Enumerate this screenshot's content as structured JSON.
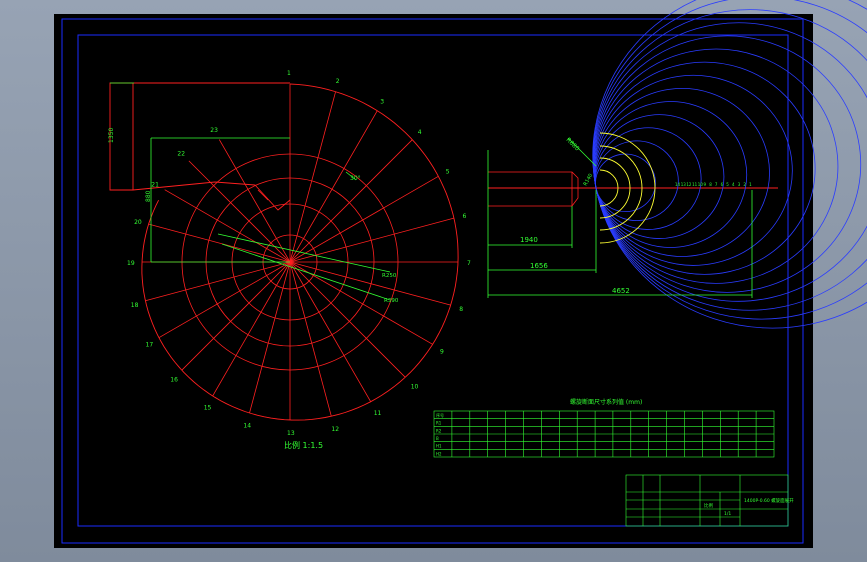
{
  "colors": {
    "background": "#000000",
    "frame_blue": "#1a2bff",
    "line_red": "#ff2020",
    "label_green": "#33ff33",
    "arc_blue": "#2a3cff",
    "arc_yellow": "#ffff33"
  },
  "left_view": {
    "angle_numbers": [
      "1",
      "2",
      "3",
      "4",
      "5",
      "6",
      "7",
      "8",
      "9",
      "10",
      "11",
      "12",
      "13",
      "14",
      "15",
      "16",
      "17",
      "18",
      "19",
      "20",
      "21",
      "22",
      "23"
    ],
    "angle_label": "30°",
    "dim_labels": [
      "R250",
      "R390",
      "1350",
      "880"
    ],
    "scale_caption": "比例 1:1.5"
  },
  "right_view": {
    "dim_1": "1940",
    "dim_2": "1656",
    "dim_3": "4652",
    "dim_diag": "R880",
    "dim_small": "R140",
    "point_numbers": [
      "14",
      "13",
      "12",
      "11",
      "10",
      "9",
      "8",
      "7",
      "6",
      "5",
      "4",
      "3",
      "2",
      "1"
    ]
  },
  "table": {
    "title": "螺旋断面尺寸系列值 (mm)",
    "row_labels": [
      "序号",
      "R1",
      "R2",
      "B",
      "H1",
      "H2"
    ],
    "columns": 19
  },
  "title_block": {
    "project": "1400P-0.60 螺旋面展开",
    "scale_label": "比例",
    "sheet_label": "1/1"
  }
}
